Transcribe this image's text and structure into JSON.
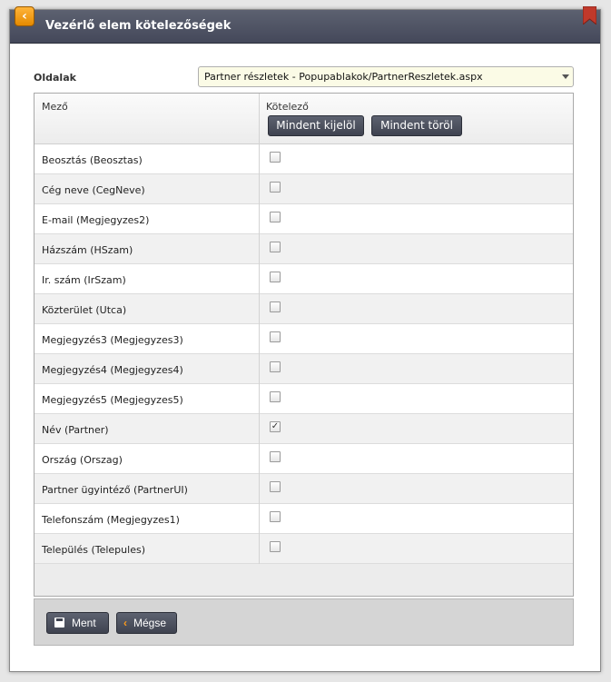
{
  "window": {
    "title": "Vezérlő elem kötelezőségek",
    "back_icon": "chevron-left-icon",
    "bookmark_icon": "bookmark-icon"
  },
  "page_selector": {
    "label": "Oldalak",
    "value": "Partner részletek - Popupablakok/PartnerReszletek.aspx"
  },
  "grid": {
    "col_field": "Mező",
    "col_required": "Kötelező",
    "select_all": "Mindent kijelöl",
    "clear_all": "Mindent töröl",
    "rows": [
      {
        "label": "Beosztás (Beosztas)",
        "checked": false
      },
      {
        "label": "Cég neve (CegNeve)",
        "checked": false
      },
      {
        "label": "E-mail (Megjegyzes2)",
        "checked": false
      },
      {
        "label": "Házszám (HSzam)",
        "checked": false
      },
      {
        "label": "Ir. szám (IrSzam)",
        "checked": false
      },
      {
        "label": "Közterület (Utca)",
        "checked": false
      },
      {
        "label": "Megjegyzés3 (Megjegyzes3)",
        "checked": false
      },
      {
        "label": "Megjegyzés4 (Megjegyzes4)",
        "checked": false
      },
      {
        "label": "Megjegyzés5 (Megjegyzes5)",
        "checked": false
      },
      {
        "label": "Név (Partner)",
        "checked": true
      },
      {
        "label": "Ország (Orszag)",
        "checked": false
      },
      {
        "label": "Partner ügyintéző (PartnerUI)",
        "checked": false
      },
      {
        "label": "Telefonszám (Megjegyzes1)",
        "checked": false
      },
      {
        "label": "Település (Telepules)",
        "checked": false
      }
    ]
  },
  "actions": {
    "save_label": "Ment",
    "cancel_label": "Mégse"
  },
  "colors": {
    "titlebar": "#4c5060",
    "accent": "#f39c12",
    "select_bg": "#fbfbe6"
  }
}
